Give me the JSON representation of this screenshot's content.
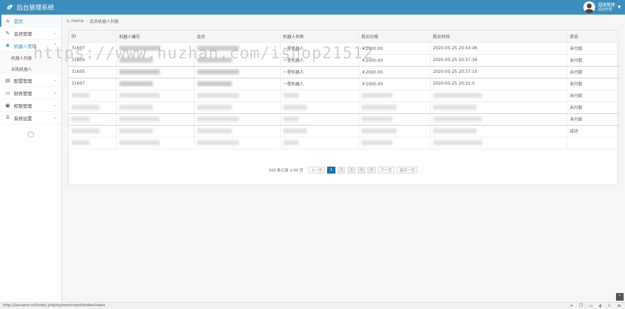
{
  "app": {
    "title": "后台管理系统"
  },
  "user": {
    "name": "超级管理",
    "sub": "超级管理"
  },
  "sidebar": {
    "items": [
      {
        "label": "首页",
        "icon": "home-icon",
        "glyph": "⌂"
      },
      {
        "label": "会员管理",
        "icon": "edit-icon",
        "glyph": "✎"
      },
      {
        "label": "机器人管理",
        "icon": "robot-icon",
        "glyph": "✱"
      },
      {
        "label": "配置管理",
        "icon": "config-icon",
        "glyph": "▤"
      },
      {
        "label": "财务管理",
        "icon": "finance-icon",
        "glyph": "▭"
      },
      {
        "label": "权限管理",
        "icon": "permission-icon",
        "glyph": "▣"
      },
      {
        "label": "系统设置",
        "icon": "settings-icon",
        "glyph": "⌸"
      }
    ],
    "subitems": [
      "机器人列表",
      "未购机器人"
    ]
  },
  "breadcrumb": {
    "home": "Home",
    "current": "会员机器人列表"
  },
  "table": {
    "headers": [
      "ID",
      "机器人编号",
      "会员",
      "机器人名称",
      "购买价格",
      "购买时间",
      "状态"
    ],
    "rows": [
      {
        "id": "31607",
        "name": "一星机器人",
        "price": "￥2000.00",
        "time": "2020-05-25 20:43:46",
        "status": "未付款"
      },
      {
        "id": "31609",
        "name": "一星机器人",
        "price": "￥2000.00",
        "time": "2020-05-25 20:37:34",
        "status": "未付款"
      },
      {
        "id": "31605",
        "name": "一星机器人",
        "price": "￥2000.00",
        "time": "2020-05-25 20:37:10",
        "status": "未付款"
      },
      {
        "id": "31607",
        "name": "一星机器人",
        "price": "￥2000.00",
        "time": "2020-05-25 20:31:5",
        "status": "未付款"
      },
      {
        "id": "",
        "name": "",
        "price": "",
        "time": "",
        "status": "未付款"
      },
      {
        "id": "",
        "name": "",
        "price": "",
        "time": "",
        "status": "未付款"
      },
      {
        "id": "",
        "name": "",
        "price": "",
        "time": "",
        "status": "未付款"
      },
      {
        "id": "",
        "name": "",
        "price": "",
        "time": "",
        "status": "成功"
      },
      {
        "id": "",
        "name": "",
        "price": "",
        "time": "",
        "status": ""
      }
    ]
  },
  "pagination": {
    "summary": "300 条记录 1/30 页",
    "prev": "上一页",
    "pages": [
      "1",
      "2",
      "3",
      "4",
      "5"
    ],
    "next": "下一页",
    "last": "最后一页"
  },
  "watermark": "https://www.huzhan.com/ishop21512",
  "statusbar": {
    "url": "http://jiaiuzed.cn/index.php/system/robot/index/index"
  }
}
